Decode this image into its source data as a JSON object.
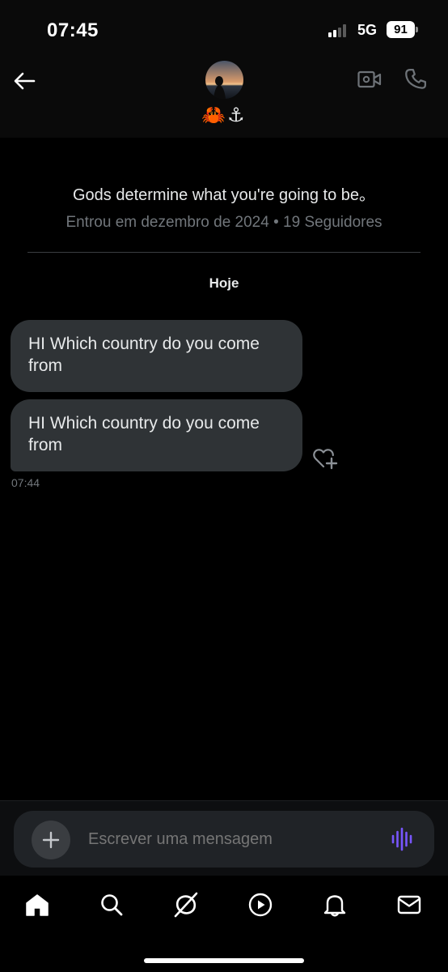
{
  "status_bar": {
    "time": "07:45",
    "network": "5G",
    "battery": "91",
    "signal_bars_active": 2,
    "signal_bars_total": 4
  },
  "header": {
    "contact_emoji_name": "🦀⚓",
    "icons": {
      "back": "back-arrow-icon",
      "video": "video-camera-icon",
      "call": "phone-icon"
    }
  },
  "profile": {
    "bio": "Gods determine what you're going to be。",
    "meta": "Entrou em dezembro de 2024 • 19 Seguidores"
  },
  "conversation": {
    "date_separator": "Hoje",
    "messages": [
      {
        "text": "HI Which country do you come from"
      },
      {
        "text": "HI Which country do you come from",
        "time": "07:44"
      }
    ]
  },
  "composer": {
    "placeholder": "Escrever uma mensagem",
    "accent_color": "#7856ff"
  },
  "nav": {
    "items": [
      "home-icon",
      "search-icon",
      "grok-icon",
      "play-icon",
      "bell-icon",
      "mail-icon"
    ]
  },
  "colors": {
    "background": "#000000",
    "bubble": "#2f3336",
    "secondary_text": "#71767b",
    "accent": "#7856ff"
  }
}
